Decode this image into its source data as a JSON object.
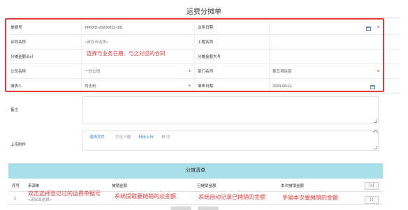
{
  "page": {
    "title": "运费分摊单"
  },
  "form": {
    "row1": {
      "label_left": "单据号",
      "value_left": "YFBXD-20200811-001",
      "label_right": "业务日期",
      "value_right": ""
    },
    "row2": {
      "label_left": "合同名称",
      "value_left": "<请双击选择>",
      "label_right": "工程名称",
      "value_right": ""
    },
    "row3": {
      "label_left": "分摊金额合计",
      "value_left": "",
      "label_right": "分摊金额大写",
      "value_right": ""
    },
    "row4": {
      "label_left": "公司名称",
      "value_left": "一分公司",
      "label_right": "部门名称",
      "value_right": "第五项目部"
    },
    "row5": {
      "label_left": "填表人",
      "value_left": "司志利",
      "label_right": "填表日期",
      "value_right": "2020-08-11"
    },
    "remark_label": "备注",
    "remark_value": "",
    "attach_label": "上传附件"
  },
  "upload": {
    "choose_file": "选择文件",
    "package_download": "打包下载",
    "scan_upload": "扫码上传",
    "sort": "排 序"
  },
  "annotations": {
    "top_hint": "选择与业务日期、与之对应的合同",
    "col1_hint": "双击选择登记过的运费单据号",
    "col2_hint": "系统提取要摊销的总金额",
    "col3_hint": "系统自动记录已摊销的金额",
    "col4_hint": "手输本次要摊销的金额"
  },
  "table": {
    "title": "分摊清单",
    "columns": [
      "序号",
      "来源单",
      "摊销金额",
      "已摊销金额",
      "本次摊销金额"
    ],
    "add_button": "[+]",
    "remove_button": "[-]",
    "rows": [
      {
        "index": "1",
        "source": "<请双击选择>",
        "amount": "",
        "amortized": "",
        "current": ""
      }
    ]
  },
  "colors": {
    "accent": "#e4393c",
    "header_bg": "#a9dfe8",
    "link": "#3b7fd0"
  }
}
